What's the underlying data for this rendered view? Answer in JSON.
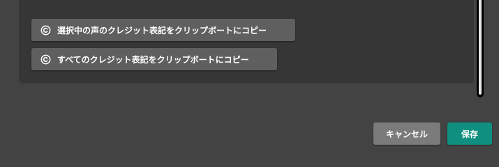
{
  "credits": {
    "copy_selected_label": "選択中の声のクレジット表記をクリップボートにコピー",
    "copy_all_label": "すべてのクレジット表記をクリップボートにコピー",
    "icon": "copyright-icon"
  },
  "footer": {
    "cancel_label": "キャンセル",
    "save_label": "保存"
  },
  "colors": {
    "background": "#434343",
    "panel": "#363636",
    "button": "#5f5f5f",
    "cancel": "#7b7b7b",
    "save_accent": "#0f8f7f"
  }
}
